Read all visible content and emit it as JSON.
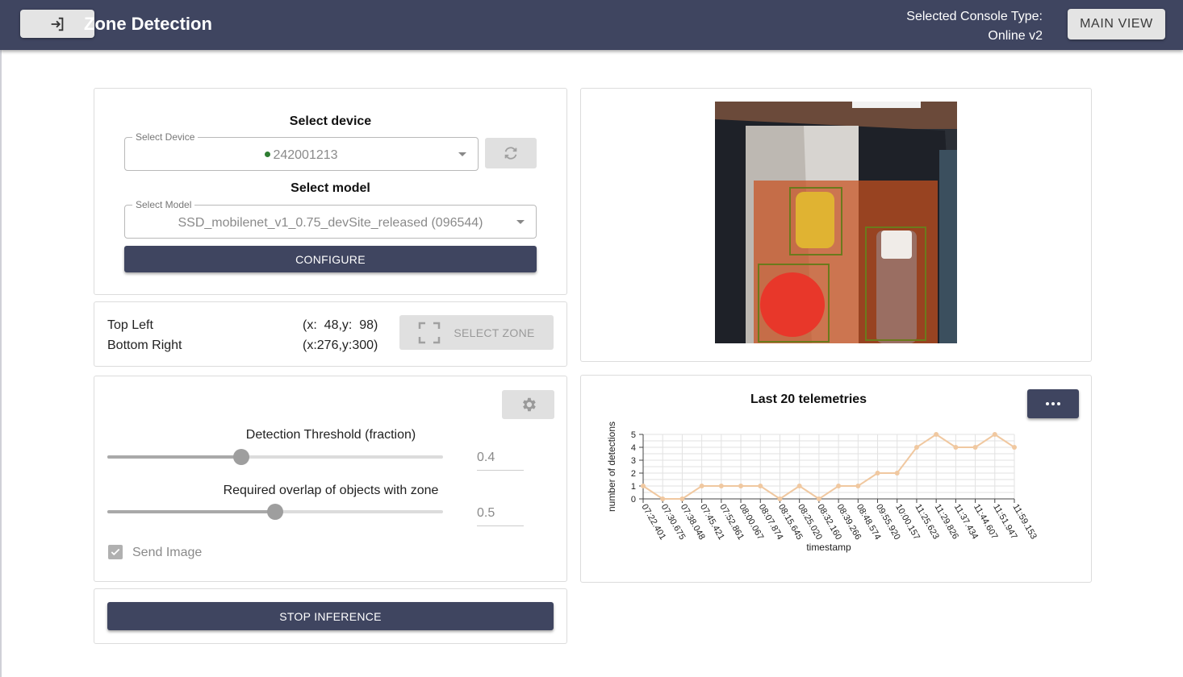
{
  "header": {
    "title": "Zone Detection",
    "console_label": "Selected Console Type:",
    "console_value": "Online v2",
    "main_view_label": "MAIN VIEW"
  },
  "device_panel": {
    "select_device_title": "Select device",
    "device_legend": "Select Device",
    "device_value": "242001213",
    "device_status_color": "#2e7d32",
    "select_model_title": "Select model",
    "model_legend": "Select Model",
    "model_value": "SSD_mobilenet_v1_0.75_devSite_released (096544)",
    "configure_label": "CONFIGURE"
  },
  "zone_panel": {
    "top_left_label": "Top Left",
    "top_left_value": "(x:  48,y:  98)",
    "bottom_right_label": "Bottom Right",
    "bottom_right_value": "(x:276,y:300)",
    "select_zone_label": "SELECT ZONE"
  },
  "settings_panel": {
    "threshold_label": "Detection Threshold (fraction)",
    "threshold_value": "0.4",
    "threshold_level": 0.4,
    "overlap_label": "Required overlap of objects with zone",
    "overlap_value": "0.5",
    "overlap_level": 0.5,
    "send_image_label": "Send Image",
    "send_image_checked": true
  },
  "stop_label": "STOP INFERENCE",
  "colors": {
    "primary": "#3f4560",
    "chart_line": "#f0c8a0",
    "zone_overlay": "#c8501e",
    "box_outline": "#6b7a1c"
  },
  "chart_data": {
    "type": "line",
    "title": "Last 20 telemetries",
    "xlabel": "timestamp",
    "ylabel": "number of detections",
    "ylim": [
      0,
      5
    ],
    "yticks": [
      "0",
      "1",
      "2",
      "3",
      "4",
      "5"
    ],
    "grid": true,
    "categories": [
      "07:22.401",
      "07:30.675",
      "07:38.048",
      "07:45.421",
      "07:52.861",
      "08:00.067",
      "08:07.874",
      "08:15.645",
      "08:25.020",
      "08:32.160",
      "08:39.266",
      "08:48.574",
      "09:55.920",
      "10:00.157",
      "11:25.623",
      "11:29.826",
      "11:37.434",
      "11:44.607",
      "11:51.947",
      "11:59.153"
    ],
    "values": [
      1,
      0,
      0,
      1,
      1,
      1,
      1,
      0,
      1,
      0,
      1,
      1,
      2,
      2,
      4,
      5,
      4,
      4,
      5,
      4
    ]
  }
}
